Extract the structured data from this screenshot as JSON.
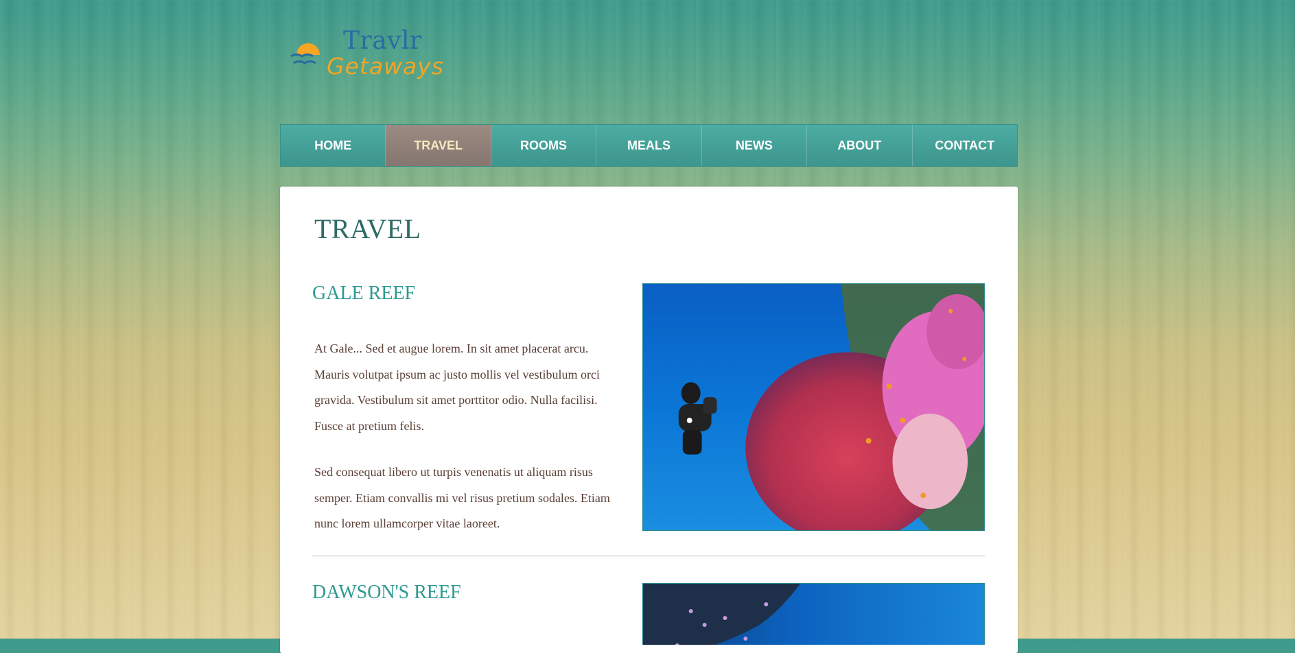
{
  "brand": {
    "name_line1": "Travlr",
    "name_line2": "Getaways",
    "colors": {
      "blue": "#2a6ba3",
      "orange": "#f0a524"
    }
  },
  "nav": {
    "items": [
      {
        "label": "HOME",
        "active": false
      },
      {
        "label": "TRAVEL",
        "active": true
      },
      {
        "label": "ROOMS",
        "active": false
      },
      {
        "label": "MEALS",
        "active": false
      },
      {
        "label": "NEWS",
        "active": false
      },
      {
        "label": "ABOUT",
        "active": false
      },
      {
        "label": "CONTACT",
        "active": false
      }
    ],
    "colors": {
      "bar": "#4cada2",
      "active": "#9b8b82",
      "active_text": "#f6e9c2"
    }
  },
  "main": {
    "page_title": "TRAVEL",
    "sections": [
      {
        "title": "GALE REEF",
        "paragraphs": [
          "At Gale... Sed et augue lorem. In sit amet placerat arcu. Mauris volutpat ipsum ac justo mollis vel vestibulum orci gravida. Vestibulum sit amet porttitor odio. Nulla facilisi. Fusce at pretium felis.",
          "Sed consequat libero ut turpis venenatis ut aliquam risus semper. Etiam convallis mi vel risus pretium sodales. Etiam nunc lorem ullamcorper vitae laoreet."
        ],
        "image": "scuba diver beside red sea fan and pink coral"
      },
      {
        "title": "DAWSON'S REEF",
        "paragraphs": [],
        "image": "coral reef wall with small fish in blue water"
      }
    ],
    "colors": {
      "title": "#2e6b64",
      "section_title": "#2d9a91",
      "body_text": "#5a3f35"
    }
  }
}
